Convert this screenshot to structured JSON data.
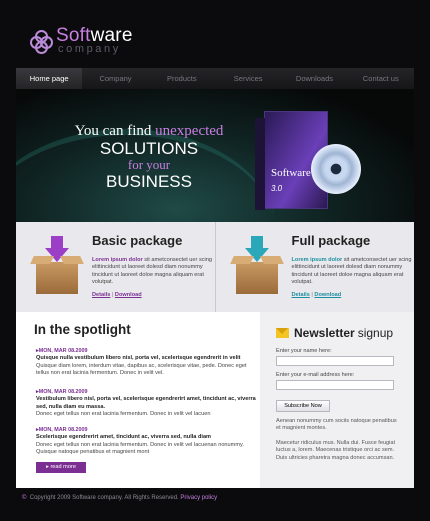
{
  "brand": {
    "title_highlight": "Soft",
    "title_rest": "ware",
    "subtitle": "company",
    "accent": "#c87fe0"
  },
  "nav": {
    "items": [
      "Home page",
      "Company",
      "Products",
      "Services",
      "Downloads",
      "Contact us"
    ],
    "active": 0
  },
  "hero": {
    "line1_pre": "You can find ",
    "line1_hl": "unexpected",
    "line2": "SOLUTIONS",
    "line3": "for your",
    "line4": "BUSINESS",
    "box_title_hl": "Soft",
    "box_title_rest": "ware",
    "box_version": "3.0",
    "box_side": "Software 3.0"
  },
  "packages": [
    {
      "title": "Basic package",
      "lead": "Lorem ipsum dolor",
      "text": " sit ametconsectet uer scing elittincidunt ut laoreet dolesd diam nonummy tincidunt ut laoreet doloe magna aliquam erat volutpat.",
      "details": "Details",
      "download": "Download",
      "arrow_color": "#9b3fc7",
      "lead_color": "#7c2f93"
    },
    {
      "title": "Full package",
      "lead": "Lorem ipsum dolor",
      "text": " sit ametconsectet uer scing elittincidunt ut laoreet dolesd diam nonummy tincidunt ut laoreet doloe magna aliquam erat volutpat.",
      "details": "Details",
      "download": "Download",
      "arrow_color": "#2aa7b8",
      "lead_color": "#1d8ea0"
    }
  ],
  "spotlight": {
    "title": "In the spotlight",
    "items": [
      {
        "date": "MON, MAR 08.2009",
        "head": "Quisque nulla vestibulum libero nisl, porta vel, scelerisque egendrerit in velit",
        "body": "Quisque diam lorem, interdum vitae, dapibus ac, scelerisque vitae, pede. Donec eget tellus non erat lacinia fermentum. Donec in velit vel."
      },
      {
        "date": "MON, MAR 08.2009",
        "head": "Vestibulum libero nisl, porta vel, scelerisque egendrerirt amet, tincidunt ac, viverra sed, nulla diam eu massa.",
        "body": "Donec eget tellus non erat lacinia fermentum. Donec in velit vel lacuen"
      },
      {
        "date": "MON, MAR 08.2009",
        "head": "Scelerisque egendrerirt amet, tincidunt ac, viverra sed, nulla diam",
        "body": "Donec eget tellus non erat lacinia fermentum. Donec in velit vel lacuenan nonummy. Quisque natoque penatibus et magnient mont"
      }
    ],
    "read_more": "read more"
  },
  "newsletter": {
    "title_strong": "Newsletter",
    "title_rest": "signup",
    "name_label": "Enter your name here:",
    "name_value": "",
    "email_label": "Enter your e-mail address here:",
    "email_value": "",
    "button": "Subscribe Now",
    "text1": "Aenean nonummy cum sociis natoque penatibus et magnient montes.",
    "text2": "Maecetur ridiculus mus. Nulla dui. Fusce feugiat luctus a, lorem. Maecenas tristique orci ac sem. Duis ultricies pharetra magna donec accumsan."
  },
  "footer": {
    "symbol": "©",
    "text": "Copyright 2009 Software company. All Rights Reserved.",
    "link": "Privacy policy"
  }
}
